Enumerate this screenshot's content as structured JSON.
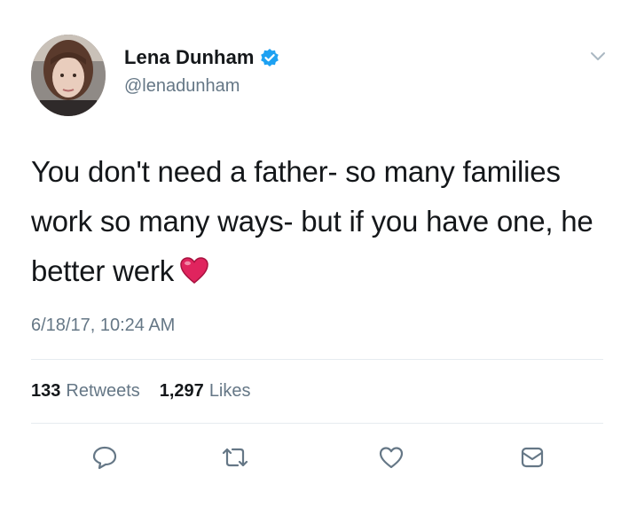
{
  "user": {
    "display_name": "Lena Dunham",
    "handle": "@lenadunham",
    "verified": true,
    "avatar_icon": "profile-photo"
  },
  "tweet": {
    "text": "You don't need a father- so many families work so many ways- but if you have one, he better werk",
    "emoji": "red-heart",
    "timestamp": "6/18/17, 10:24 AM"
  },
  "stats": {
    "retweets_count": "133",
    "retweets_label": "Retweets",
    "likes_count": "1,297",
    "likes_label": "Likes"
  },
  "actions": [
    {
      "icon": "reply-icon"
    },
    {
      "icon": "retweet-icon"
    },
    {
      "icon": "like-icon"
    },
    {
      "icon": "direct-message-icon"
    }
  ],
  "colors": {
    "text": "#14171a",
    "secondary": "#657786",
    "verified": "#1da1f2",
    "divider": "#e6ecf0",
    "heart": "#e0245e"
  }
}
